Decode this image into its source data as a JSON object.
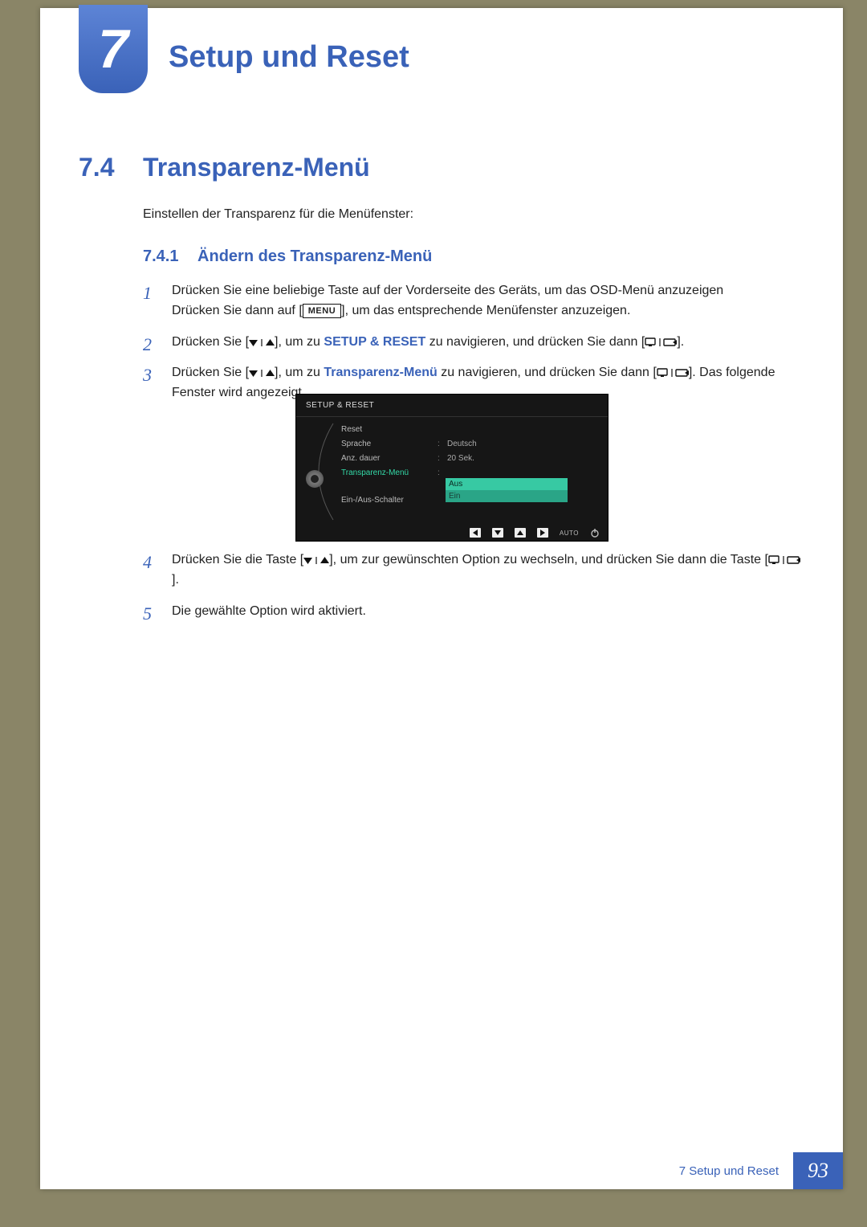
{
  "chapter": {
    "number": "7",
    "title": "Setup und Reset"
  },
  "section": {
    "number": "7.4",
    "title": "Transparenz-Menü"
  },
  "intro": "Einstellen der Transparenz für die Menüfenster:",
  "subsection": {
    "number": "7.4.1",
    "title": "Ändern des Transparenz-Menü"
  },
  "steps": {
    "s1a": "Drücken Sie eine beliebige Taste auf der Vorderseite des Geräts, um das OSD-Menü anzuzeigen",
    "s1b_pre": "Drücken Sie dann auf [",
    "s1b_menu": "MENU",
    "s1b_post": "], um das entsprechende Menüfenster anzuzeigen.",
    "s2_pre": "Drücken Sie [",
    "s2_mid": "], um zu ",
    "s2_target": "SETUP & RESET",
    "s2_nav": " zu navigieren, und drücken Sie dann [",
    "s2_end": "].",
    "s3_pre": "Drücken Sie [",
    "s3_mid": "], um zu ",
    "s3_target": "Transparenz-Menü",
    "s3_nav": " zu navigieren, und drücken Sie dann [",
    "s3_end": "]. Das folgende Fenster wird angezeigt.",
    "s4_pre": "Drücken Sie die Taste [",
    "s4_mid": "], um zur gewünschten Option zu wechseln, und drücken Sie dann die Taste [",
    "s4_end": "].",
    "s5": "Die gewählte Option wird aktiviert."
  },
  "osd": {
    "header": "SETUP & RESET",
    "items": [
      {
        "label": "Reset",
        "value": ""
      },
      {
        "label": "Sprache",
        "value": "Deutsch"
      },
      {
        "label": "Anz. dauer",
        "value": "20 Sek."
      },
      {
        "label": "Transparenz-Menü",
        "value": "Aus",
        "highlight": true
      },
      {
        "label": "Ein-/Aus-Schalter",
        "value": ""
      }
    ],
    "dropdown": {
      "selected": "Aus",
      "other": "Ein"
    },
    "footer_auto": "AUTO"
  },
  "footer": {
    "label": "7 Setup und Reset",
    "page": "93"
  }
}
